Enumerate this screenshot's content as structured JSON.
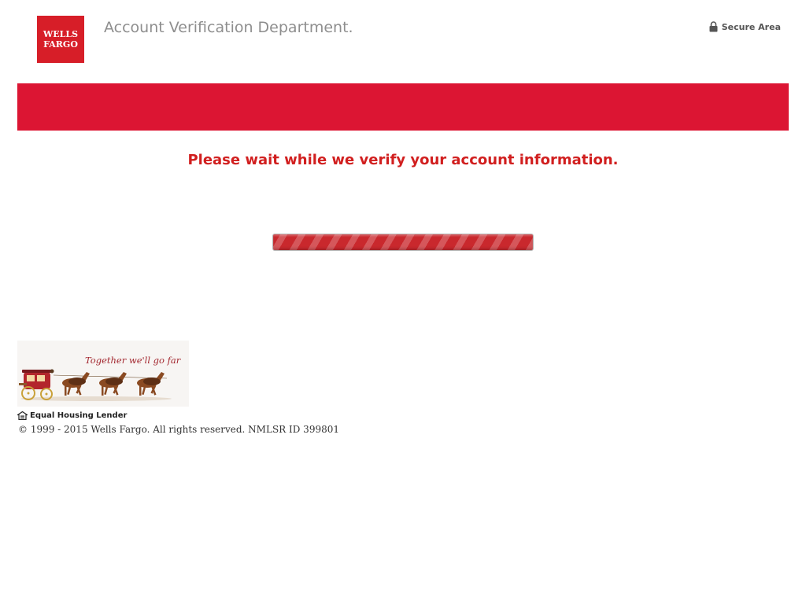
{
  "header": {
    "logo_line1": "WELLS",
    "logo_line2": "FARGO",
    "logo_color": "#d71e28",
    "title": "Account Verification Department.",
    "secure_icon": "lock-icon",
    "secure_label": "Secure Area"
  },
  "band": {
    "color": "#dc1533"
  },
  "main": {
    "wait_message": "Please wait while we verify your account information.",
    "progress": {
      "state": "indeterminate",
      "style": "animated-stripes",
      "color": "#c9282d"
    }
  },
  "footer": {
    "tagline": "Together we'll go far",
    "stagecoach_icon": "stagecoach-illustration",
    "ehl_icon": "equal-housing-icon",
    "ehl_label": "Equal Housing Lender",
    "copyright": "© 1999 - 2015 Wells Fargo. All rights reserved. NMLSR ID 399801"
  }
}
